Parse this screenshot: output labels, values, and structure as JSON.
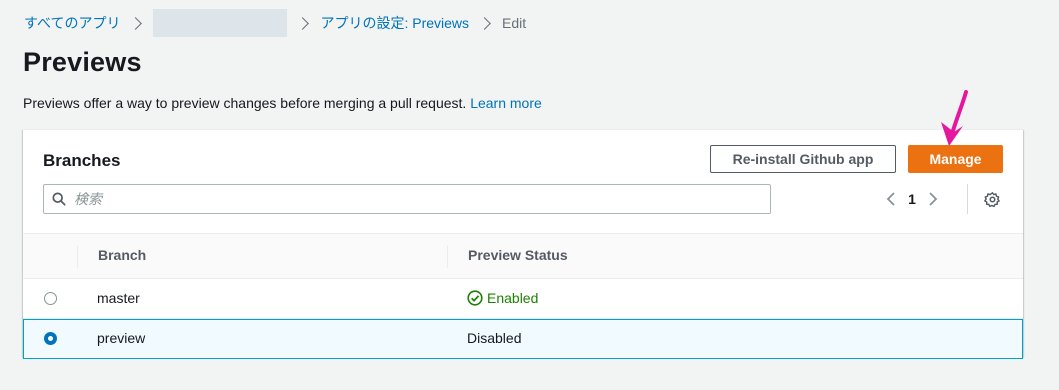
{
  "breadcrumb": {
    "all_apps": "すべてのアプリ",
    "app_settings": "アプリの設定: Previews",
    "current": "Edit"
  },
  "page": {
    "title": "Previews",
    "description": "Previews offer a way to preview changes before merging a pull request.",
    "learn_more": "Learn more"
  },
  "panel": {
    "title": "Branches",
    "reinstall_label": "Re-install Github app",
    "manage_label": "Manage"
  },
  "search": {
    "placeholder": "検索"
  },
  "pagination": {
    "current_page": "1"
  },
  "table": {
    "columns": [
      "Branch",
      "Preview Status"
    ],
    "rows": [
      {
        "branch": "master",
        "status": "Enabled",
        "selected": false
      },
      {
        "branch": "preview",
        "status": "Disabled",
        "selected": true
      }
    ]
  },
  "icons": {
    "search": "search-icon",
    "settings": "gear-icon",
    "prev": "chevron-left-icon",
    "next": "chevron-right-icon",
    "status_ok": "check-circle-icon"
  },
  "colors": {
    "primary_button": "#ec7211",
    "link": "#0073bb",
    "success": "#1d8102",
    "annotation": "#e6179f"
  }
}
